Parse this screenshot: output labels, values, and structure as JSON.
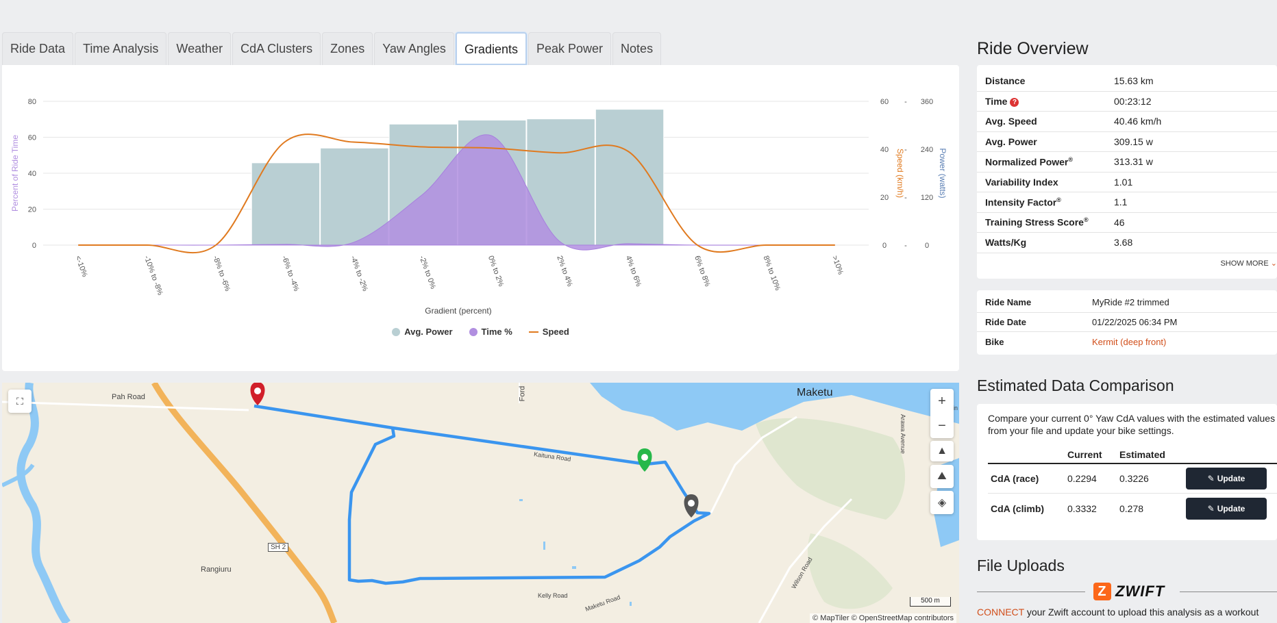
{
  "tabs": [
    {
      "label": "Ride Data"
    },
    {
      "label": "Time Analysis"
    },
    {
      "label": "Weather"
    },
    {
      "label": "CdA Clusters"
    },
    {
      "label": "Zones"
    },
    {
      "label": "Yaw Angles"
    },
    {
      "label": "Gradients",
      "active": true
    },
    {
      "label": "Peak Power"
    },
    {
      "label": "Notes"
    }
  ],
  "chart_data": {
    "type": "bar",
    "title": "",
    "xlabel": "Gradient (percent)",
    "categories": [
      "<-10%",
      "-10% to -8%",
      "-8% to -6%",
      "-6% to -4%",
      "-4% to -2%",
      "-2% to 0%",
      "0% to 2%",
      "2% to 4%",
      "4% to 6%",
      "6% to 8%",
      "8% to 10%",
      ">10%"
    ],
    "axes": {
      "left": {
        "label": "Percent of Ride Time",
        "ticks": [
          0,
          20,
          40,
          60,
          80
        ],
        "ylim": [
          0,
          80
        ],
        "color": "#b18fe0"
      },
      "right1": {
        "label": "Speed (km/h)",
        "ticks": [
          0,
          20,
          40,
          60
        ],
        "ylim": [
          0,
          60
        ],
        "color": "#e07a1f"
      },
      "right2": {
        "label": "Power (watts)",
        "ticks": [
          0,
          120,
          240,
          360
        ],
        "ylim": [
          0,
          360
        ],
        "color": "#5b7fb4"
      }
    },
    "grid": true,
    "legend_position": "bottom",
    "series": [
      {
        "name": "Avg. Power",
        "type": "bar",
        "axis": "right2",
        "color": "#b9cfd3",
        "values": [
          0,
          0,
          0,
          206,
          243,
          303,
          313,
          316,
          340,
          0,
          0,
          0
        ]
      },
      {
        "name": "Time %",
        "type": "area",
        "axis": "left",
        "color": "#b18fe0",
        "values": [
          0,
          0,
          0,
          0.4,
          1.5,
          28,
          61,
          2,
          0.8,
          0,
          0,
          0
        ]
      },
      {
        "name": "Speed",
        "type": "line",
        "axis": "right1",
        "color": "#e07a1f",
        "values": [
          0,
          0,
          0,
          43,
          43,
          41,
          40.5,
          38.5,
          39,
          0,
          0,
          0
        ]
      }
    ]
  },
  "map": {
    "labels": {
      "pah_road": "Pah Road",
      "ford": "Ford",
      "maketu": "Maketu",
      "rangiuru": "Rangiuru",
      "sh2": "SH 2",
      "kaituna_road": "Kaituna Road",
      "kelly_road": "Kelly Road",
      "maketu_road": "Maketu Road",
      "wilson_road": "Wilson Road",
      "arawa_avenue": "Arawa Avenue",
      "lin": "Lin"
    },
    "scale": "500 m",
    "attribution": "© MapTiler © OpenStreetMap contributors",
    "controls": {
      "zoom_in": "+",
      "zoom_out": "−"
    }
  },
  "overview": {
    "title": "Ride Overview",
    "rows": [
      {
        "label": "Distance",
        "value": "15.63 km"
      },
      {
        "label": "Time",
        "value": "00:23:12",
        "help": "?"
      },
      {
        "label": "Avg. Speed",
        "value": "40.46 km/h"
      },
      {
        "label": "Avg. Power",
        "value": "309.15 w"
      },
      {
        "label": "Normalized Power",
        "sup": "®",
        "value": "313.31 w"
      },
      {
        "label": "Variability Index",
        "value": "1.01"
      },
      {
        "label": "Intensity Factor",
        "sup": "®",
        "value": "1.1"
      },
      {
        "label": "Training Stress Score",
        "sup": "®",
        "value": "46"
      },
      {
        "label": "Watts/Kg",
        "value": "3.68"
      }
    ],
    "show_more": "SHOW MORE"
  },
  "ride_info": {
    "name_label": "Ride Name",
    "name_value": "MyRide #2 trimmed",
    "date_label": "Ride Date",
    "date_value": "01/22/2025 06:34 PM",
    "bike_label": "Bike",
    "bike_value": "Kermit (deep front)"
  },
  "comparison": {
    "title": "Estimated Data Comparison",
    "description": "Compare your current 0° Yaw CdA values with the estimated values from your file and update your bike settings.",
    "head_current": "Current",
    "head_estimated": "Estimated",
    "rows": [
      {
        "label": "CdA (race)",
        "current": "0.2294",
        "estimated": "0.3226",
        "button": "Update"
      },
      {
        "label": "CdA (climb)",
        "current": "0.3332",
        "estimated": "0.278",
        "button": "Update"
      }
    ]
  },
  "uploads": {
    "title": "File Uploads",
    "zwift_logo": "ZWIFT",
    "zwift_z": "Z",
    "connect_link": "CONNECT",
    "connect_text": "your Zwift account to upload this analysis as a workout"
  }
}
